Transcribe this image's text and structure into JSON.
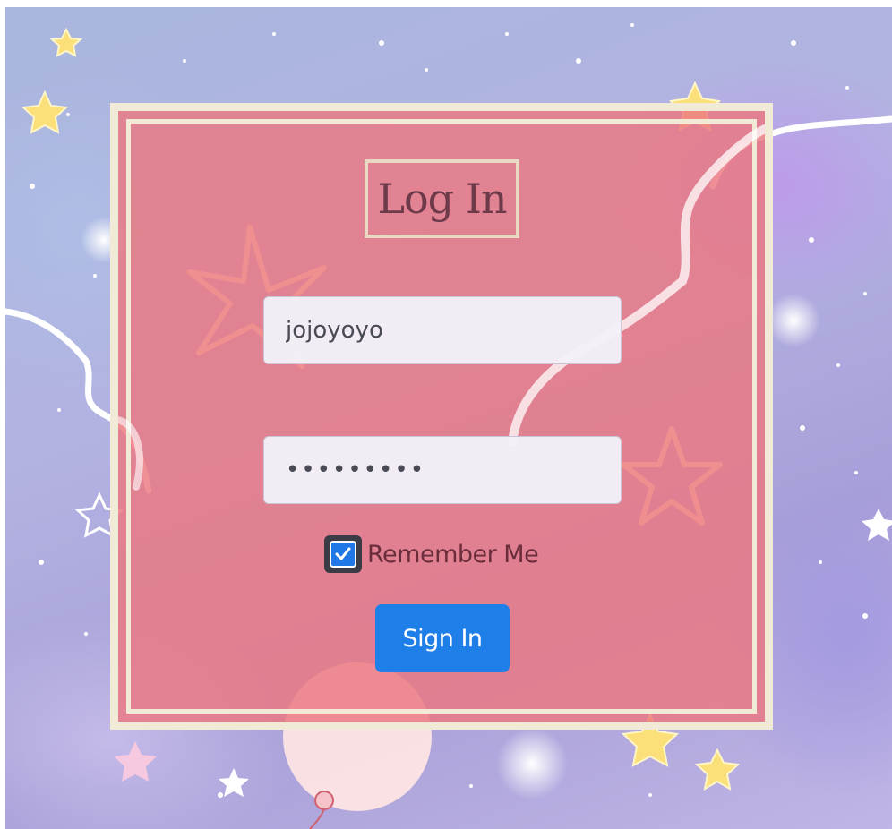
{
  "login": {
    "title": "Log In",
    "username": {
      "value": "jojoyoyo",
      "placeholder": ""
    },
    "password": {
      "value": "•••••••••",
      "placeholder": ""
    },
    "remember_label": "Remember Me",
    "remember_checked": true,
    "signin_label": "Sign In"
  },
  "colors": {
    "panel_fill": "#ec7880",
    "panel_border": "#f1ead6",
    "button": "#1f7fe8",
    "checkbox": "#1f78e6",
    "title_text": "#6d3a4a"
  },
  "icons": {
    "check": "checkmark-icon",
    "background": [
      "star-icon",
      "balloon-icon"
    ]
  }
}
